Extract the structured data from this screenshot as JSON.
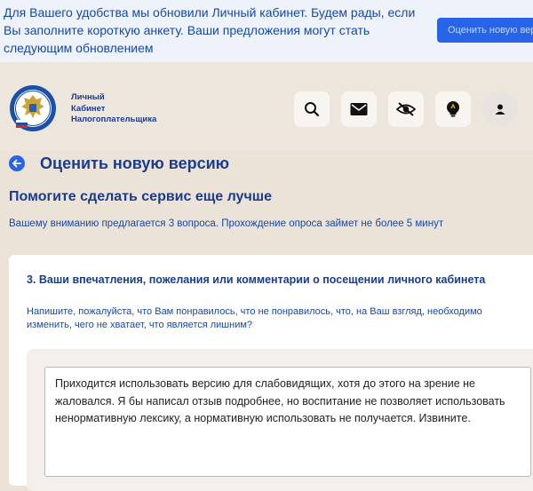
{
  "banner": {
    "message": "Для Вашего удобства мы обновили Личный кабинет. Будем рады, если Вы заполните короткую анкету. Ваши предложения могут стать следующим обновлением",
    "button_label": "Оценить новую версию"
  },
  "header": {
    "brand_line1": "Личный",
    "brand_line2": "Кабинет",
    "brand_line3": "Налогоплательщика",
    "icons": [
      "search-icon",
      "mail-icon",
      "eye-off-icon",
      "lightbulb-icon",
      "user-icon"
    ]
  },
  "page": {
    "title": "Оценить новую версию",
    "section_title": "Помогите сделать сервис еще лучше",
    "section_desc": "Вашему вниманию предлагается 3 вопроса. Прохождение опроса займет не более 5 минут"
  },
  "question": {
    "title": "3. Ваши впечатления, пожелания или комментарии о посещении личного кабинета",
    "hint": "Напишите, пожалуйста, что Вам понравилось, что не понравилось, что, на Ваш взгляд, необходимо изменить, чего не хватает, что является лишним?",
    "answer": "Приходится использовать версию для слабовидящих, хотя до этого на зрение не жаловался. Я бы написал отзыв подробнее, но воспитание не позволяет использовать ненормативную лексику, а нормативную использовать не получается. Извините."
  },
  "colors": {
    "accent": "#2764e8",
    "heading": "#1b3c8c",
    "text_blue": "#1747a8",
    "page_bg": "#ebe3d8"
  }
}
